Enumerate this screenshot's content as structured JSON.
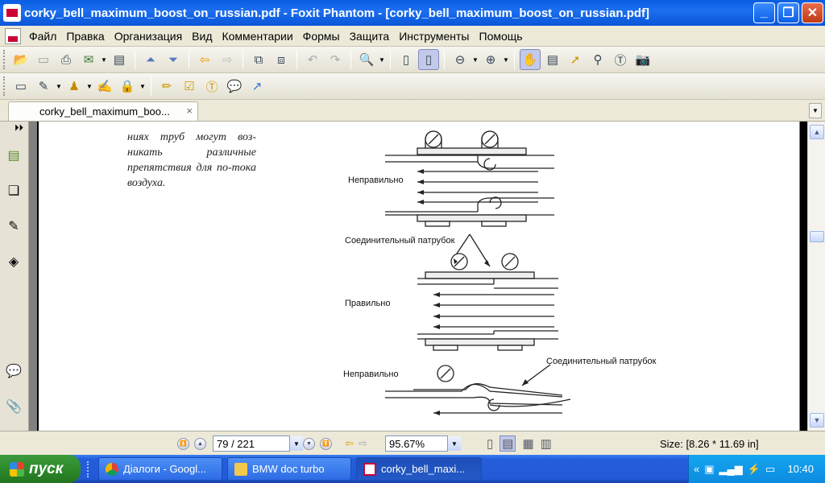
{
  "window": {
    "title": "corky_bell_maximum_boost_on_russian.pdf - Foxit Phantom - [corky_bell_maximum_boost_on_russian.pdf]",
    "buttons": {
      "minimize": "_",
      "maximize": "❐",
      "close": "✕"
    }
  },
  "menu": {
    "items": [
      "Файл",
      "Правка",
      "Организация",
      "Вид",
      "Комментарии",
      "Формы",
      "Защита",
      "Инструменты",
      "Помощь"
    ]
  },
  "toolbar1": {
    "icons": [
      "open-icon",
      "save-icon",
      "print-icon",
      "email-icon",
      "scan-icon",
      "prev-page-icon",
      "next-page-icon",
      "back-icon",
      "forward-icon",
      "extract-page-icon",
      "insert-page-icon",
      "undo-icon",
      "redo-icon",
      "zoom-in-icon",
      "fit-page-icon",
      "fit-width-icon",
      "zoom-out-minus-icon",
      "zoom-in-plus-icon",
      "hand-tool-icon",
      "select-text-icon",
      "select-arrow-icon",
      "find-icon",
      "typewriter-icon",
      "snapshot-icon"
    ]
  },
  "toolbar2": {
    "icons": [
      "single-page-icon",
      "edit-text-icon",
      "stamp-icon",
      "sign-icon",
      "lock-icon",
      "highlight-icon",
      "form-icon",
      "textbox-icon",
      "note-icon",
      "arrow-icon"
    ]
  },
  "tabs": {
    "doc_tab_label": "corky_bell_maximum_boo...",
    "close_glyph": "×"
  },
  "document": {
    "italic_text": "ниях труб могут воз-никать различные препятствия для по-тока воздуха.",
    "labels": {
      "wrong1": "Неправильно",
      "connector1": "Соединительный патрубок",
      "right": "Правильно",
      "wrong2": "Неправильно",
      "connector2": "Соединительный патрубок"
    }
  },
  "statusbar": {
    "page_value": "79 / 221",
    "zoom_value": "95.67%",
    "size_text": "Size: [8.26 * 11.69 in]"
  },
  "taskbar": {
    "start_label": "пуск",
    "tasks": [
      {
        "label": "Діалоги - Googl..."
      },
      {
        "label": "BMW doc turbo"
      },
      {
        "label": "corky_bell_maxi..."
      }
    ],
    "clock": "10:40"
  }
}
